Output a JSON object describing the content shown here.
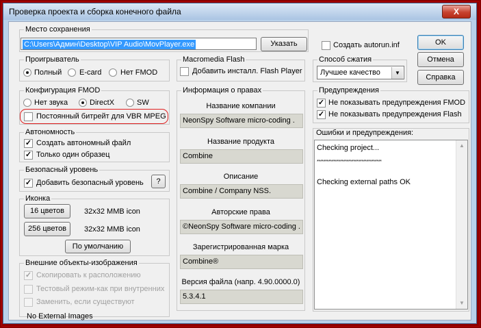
{
  "window": {
    "title": "Проверка проекта и сборка конечного файла",
    "close_label": "X"
  },
  "save": {
    "group_title": "Место сохранения",
    "path_value": "C:\\Users\\Админ\\Desktop\\VIP Audio\\MovPlayer.exe",
    "browse_label": "Указать"
  },
  "autorun": {
    "label": "Создать autorun.inf",
    "checked": false
  },
  "buttons": {
    "ok": "OK",
    "cancel": "Отмена",
    "help": "Справка"
  },
  "player": {
    "group_title": "Проигрыватель",
    "options": [
      {
        "label": "Полный",
        "selected": true
      },
      {
        "label": "E-card",
        "selected": false
      },
      {
        "label": "Нет FMOD",
        "selected": false
      }
    ]
  },
  "flash": {
    "group_title": "Macromedia Flash",
    "add_installer_label": "Добавить инсталл. Flash Player",
    "checked": false
  },
  "compression": {
    "group_title": "Способ сжатия",
    "selected": "Лучшее качество"
  },
  "fmod": {
    "group_title": "Конфигурация FMOD",
    "options": [
      {
        "label": "Нет звука",
        "selected": false
      },
      {
        "label": "DirectX",
        "selected": true
      },
      {
        "label": "SW",
        "selected": false
      }
    ],
    "constant_bitrate_label": "Постоянный битрейт для VBR MPEG",
    "constant_bitrate_checked": false
  },
  "autonomy": {
    "group_title": "Автономность",
    "items": [
      {
        "label": "Создать автономный файл",
        "checked": true
      },
      {
        "label": "Только один образец",
        "checked": true
      }
    ]
  },
  "security": {
    "group_title": "Безопасный уровень",
    "add_label": "Добавить безопасный уровень",
    "checked": true,
    "help_label": "?"
  },
  "icon": {
    "group_title": "Иконка",
    "rows": [
      {
        "button": "16 цветов",
        "info": "32x32 MMB icon"
      },
      {
        "button": "256 цветов",
        "info": "32x32 MMB icon"
      }
    ],
    "default_label": "По умолчанию"
  },
  "images": {
    "group_title": "Внешние объекты-изображения",
    "items": [
      {
        "label": "Скопировать к расположению",
        "checked": true
      },
      {
        "label": "Тестовый режим-как при внутренних",
        "checked": false
      },
      {
        "label": "Заменить, если существуют",
        "checked": false
      }
    ],
    "status": "No External Images"
  },
  "rights": {
    "group_title": "Информация о правах",
    "fields": [
      {
        "label": "Название компании",
        "value": "NeonSpy Software micro-coding ."
      },
      {
        "label": "Название продукта",
        "value": "Combine"
      },
      {
        "label": "Описание",
        "value": "Combine / Company NSS."
      },
      {
        "label": "Авторские права",
        "value": "©NeonSpy Software micro-coding ."
      },
      {
        "label": "Зарегистрированная марка",
        "value": "Combine®"
      },
      {
        "label": "Версия файла (напр. 4.90.0000.0)",
        "value": "5.3.4.1"
      }
    ]
  },
  "warnings": {
    "group_title": "Предупреждения",
    "items": [
      {
        "label": "Не показывать предупреждения FMOD",
        "checked": true
      },
      {
        "label": "Не показывать предупреждения Flash",
        "checked": true
      }
    ]
  },
  "log": {
    "title": "Ошибки и предупреждения:",
    "lines": [
      "Checking project...",
      "***************************************",
      "Checking external paths OK"
    ]
  },
  "colors": {
    "highlight": "#e02020",
    "selection": "#3399ff"
  }
}
